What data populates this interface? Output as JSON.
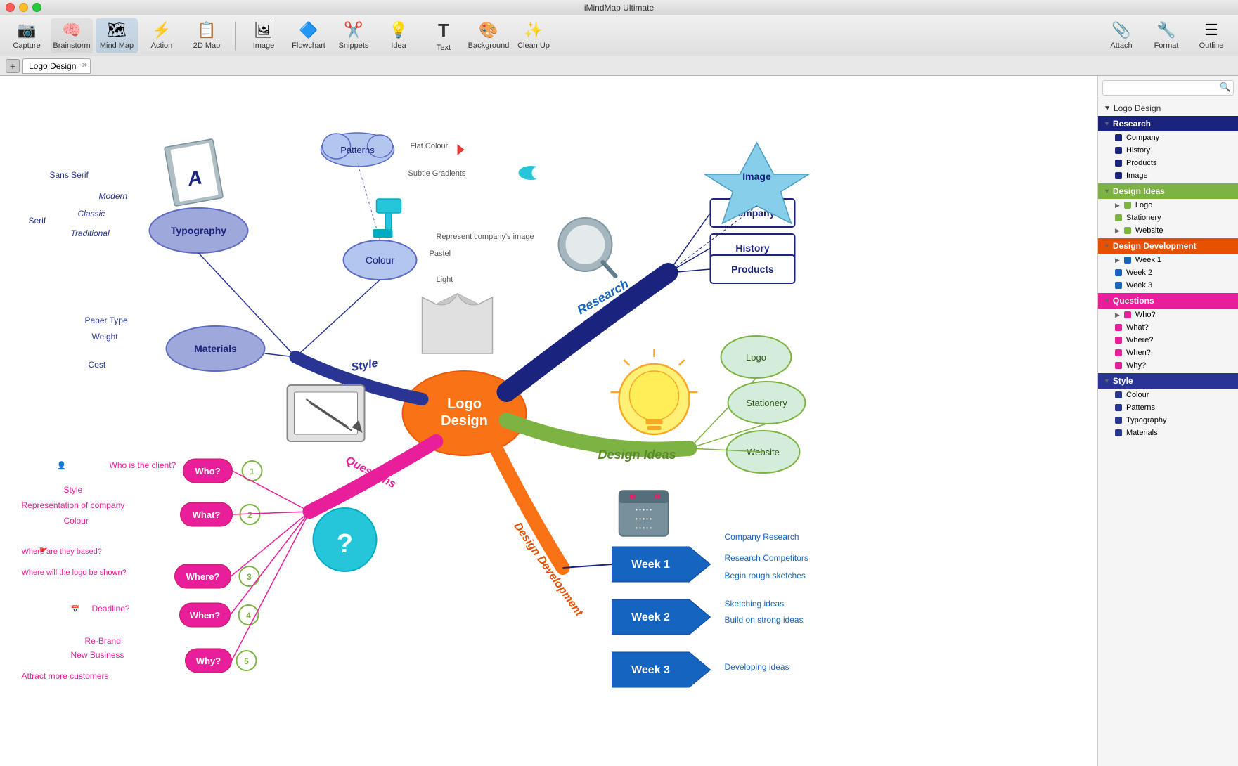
{
  "app": {
    "title": "iMindMap Ultimate"
  },
  "toolbar": {
    "left_items": [
      {
        "id": "capture",
        "label": "Capture",
        "icon": "📷"
      },
      {
        "id": "brainstorm",
        "label": "Brainstorm",
        "icon": "💡"
      },
      {
        "id": "mind-map",
        "label": "Mind Map",
        "icon": "🗺"
      },
      {
        "id": "action",
        "label": "Action",
        "icon": "⚡"
      },
      {
        "id": "2d-map",
        "label": "2D Map",
        "icon": "📋"
      }
    ],
    "middle_items": [
      {
        "id": "image",
        "label": "Image",
        "icon": "🖼"
      },
      {
        "id": "flowchart",
        "label": "Flowchart",
        "icon": "🔷"
      },
      {
        "id": "snippets",
        "label": "Snippets",
        "icon": "✂"
      },
      {
        "id": "idea",
        "label": "Idea",
        "icon": "💡"
      },
      {
        "id": "text",
        "label": "Text",
        "icon": "T"
      },
      {
        "id": "background",
        "label": "Background",
        "icon": "🎨"
      },
      {
        "id": "cleanup",
        "label": "Clean Up",
        "icon": "✨"
      }
    ],
    "right_items": [
      {
        "id": "attach",
        "label": "Attach",
        "icon": "📎"
      },
      {
        "id": "format",
        "label": "Format",
        "icon": "🔧"
      },
      {
        "id": "outline",
        "label": "Outline",
        "icon": "☰"
      }
    ]
  },
  "tab": {
    "title": "Logo Design"
  },
  "search": {
    "placeholder": ""
  },
  "panel": {
    "title": "Logo Design",
    "sections": [
      {
        "id": "research",
        "label": "Research",
        "color": "#1a237e",
        "expanded": true,
        "items": [
          {
            "label": "Company",
            "color": "#1a237e",
            "expanded": false
          },
          {
            "label": "History",
            "color": "#1a237e",
            "expanded": false
          },
          {
            "label": "Products",
            "color": "#1a237e",
            "expanded": false
          },
          {
            "label": "Image",
            "color": "#1a237e",
            "expanded": false
          }
        ]
      },
      {
        "id": "design-ideas",
        "label": "Design Ideas",
        "color": "#7cb342",
        "expanded": true,
        "items": [
          {
            "label": "Logo",
            "color": "#7cb342",
            "expanded": true
          },
          {
            "label": "Stationery",
            "color": "#7cb342",
            "expanded": false
          },
          {
            "label": "Website",
            "color": "#7cb342",
            "expanded": true
          }
        ]
      },
      {
        "id": "design-development",
        "label": "Design Development",
        "color": "#e65100",
        "expanded": true,
        "items": [
          {
            "label": "Week 1",
            "color": "#1565c0",
            "expanded": true
          },
          {
            "label": "Week 2",
            "color": "#1565c0",
            "expanded": false
          },
          {
            "label": "Week 3",
            "color": "#1565c0",
            "expanded": false
          }
        ]
      },
      {
        "id": "questions",
        "label": "Questions",
        "color": "#e91e9a",
        "expanded": true,
        "items": [
          {
            "label": "Who?",
            "color": "#e91e9a",
            "expanded": true
          },
          {
            "label": "What?",
            "color": "#e91e9a",
            "expanded": false
          },
          {
            "label": "Where?",
            "color": "#e91e9a",
            "expanded": false
          },
          {
            "label": "When?",
            "color": "#e91e9a",
            "expanded": false
          },
          {
            "label": "Why?",
            "color": "#e91e9a",
            "expanded": false
          }
        ]
      },
      {
        "id": "style",
        "label": "Style",
        "color": "#283593",
        "expanded": true,
        "items": [
          {
            "label": "Colour",
            "color": "#283593",
            "expanded": false
          },
          {
            "label": "Patterns",
            "color": "#283593",
            "expanded": false
          },
          {
            "label": "Typography",
            "color": "#283593",
            "expanded": false
          },
          {
            "label": "Materials",
            "color": "#283593",
            "expanded": false
          }
        ]
      }
    ]
  }
}
